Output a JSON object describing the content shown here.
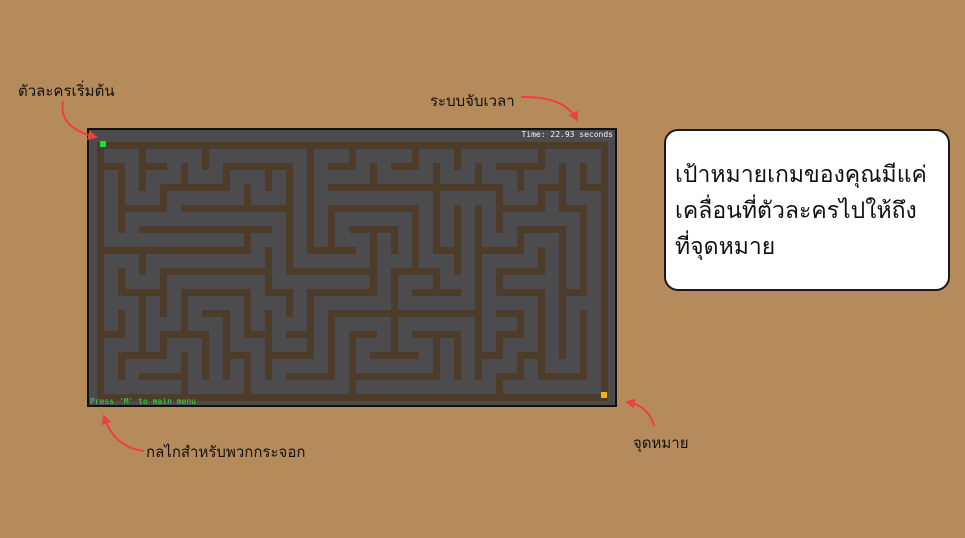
{
  "game": {
    "timer_text": "Time: 22.93 seconds",
    "hint_text": "Press 'M' to main menu"
  },
  "annotations": {
    "start_character": "ตัวละครเริ่มต้น",
    "timer_system": "ระบบจับเวลา",
    "controls": "กลไกสำหรับพวกกระจอก",
    "destination": "จุดหมาย"
  },
  "goal": {
    "lines": [
      "เป้าหมายเกมของคุณมีแค่",
      "เคลื่อนที่ตัวละครไปให้ถึง",
      "ที่จุดหมาย"
    ]
  },
  "colors": {
    "background": "#b68b5c",
    "maze_path": "#4c4c4f",
    "maze_wall": "#4e3c2b",
    "player": "#22dd33",
    "target": "#f2b022",
    "arrow": "#ee4040",
    "hint": "#2ee048"
  },
  "icons": {
    "player": "green-square-player",
    "target": "yellow-square-target"
  }
}
